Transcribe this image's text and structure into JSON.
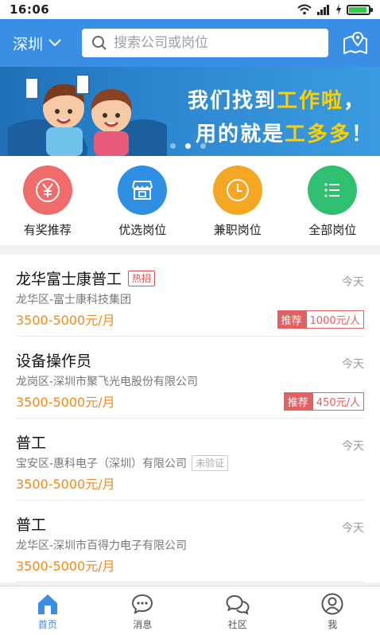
{
  "status_bar": {
    "time": "16:06",
    "battery_level": 0.85
  },
  "header": {
    "city": "深圳",
    "search_placeholder": "搜索公司或岗位"
  },
  "banner": {
    "line1_prefix": "我们找到",
    "line1_highlight": "工作啦",
    "line1_suffix": "，",
    "line2_prefix": "用的就是",
    "line2_highlight": "工多多",
    "line2_suffix": "！",
    "active_dot": 2
  },
  "categories": [
    {
      "label": "有奖推荐",
      "color": "#f06b6b",
      "icon": "yen-icon"
    },
    {
      "label": "优选岗位",
      "color": "#2f8fe3",
      "icon": "shop-icon"
    },
    {
      "label": "兼职岗位",
      "color": "#f5a623",
      "icon": "clock-icon"
    },
    {
      "label": "全部岗位",
      "color": "#2fbf71",
      "icon": "list-icon"
    }
  ],
  "jobs": [
    {
      "title": "龙华富士康普工",
      "tag": "热招",
      "company": "龙华区-富士康科技集团",
      "salary": "3500-5000元/月",
      "date": "今天",
      "reward_label": "推荐",
      "reward_amount": "1000元/人"
    },
    {
      "title": "设备操作员",
      "tag": "",
      "company": "龙岗区-深圳市聚飞光电股份有限公司",
      "salary": "3500-5000元/月",
      "date": "今天",
      "reward_label": "推荐",
      "reward_amount": "450元/人"
    },
    {
      "title": "普工",
      "tag": "",
      "company": "宝安区-惠科电子（深圳）有限公司",
      "company_tag": "未验证",
      "salary": "3500-5000元/月",
      "date": "今天"
    },
    {
      "title": "普工",
      "tag": "",
      "company": "龙华区-深圳市百得力电子有限公司",
      "salary": "3500-5000元/月",
      "date": "今天"
    }
  ],
  "bottom_nav": [
    {
      "label": "首页",
      "icon": "home-icon",
      "active": true
    },
    {
      "label": "消息",
      "icon": "message-icon",
      "active": false
    },
    {
      "label": "社区",
      "icon": "community-icon",
      "active": false
    },
    {
      "label": "我",
      "icon": "profile-icon",
      "active": false
    }
  ],
  "colors": {
    "primary": "#3a8ee6",
    "salary": "#f08a1c",
    "hot": "#e24d4d"
  }
}
